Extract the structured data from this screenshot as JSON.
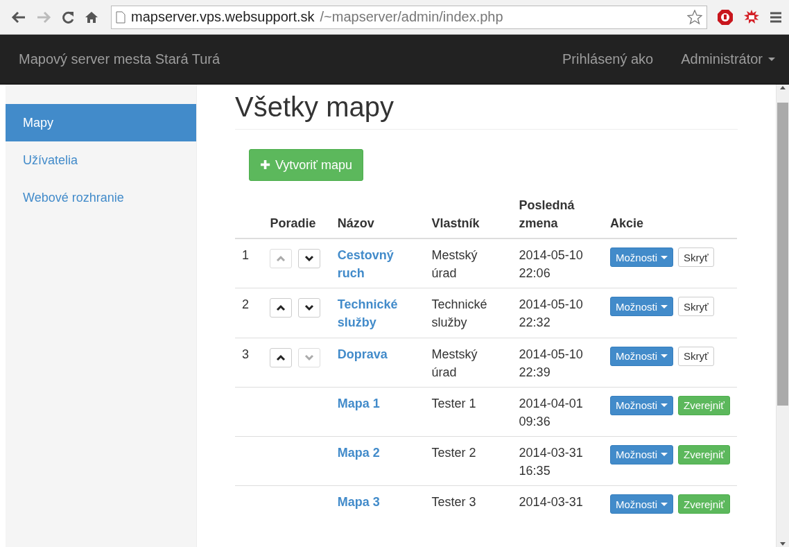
{
  "browser": {
    "url_host": "mapserver.vps.websupport.sk",
    "url_path": "/~mapserver/admin/index.php"
  },
  "navbar": {
    "brand": "Mapový server mesta Stará Turá",
    "logged_in_label": "Prihlásený ako",
    "user_menu": "Administrátor"
  },
  "sidebar": {
    "items": [
      {
        "label": "Mapy",
        "selected": true
      },
      {
        "label": "Užívatelia",
        "selected": false
      },
      {
        "label": "Webové rozhranie",
        "selected": false
      }
    ]
  },
  "page_title": "Všetky mapy",
  "create_button": {
    "icon": "✚",
    "label": "Vytvoriť mapu"
  },
  "table": {
    "columns": [
      "",
      "Poradie",
      "Názov",
      "Vlastník",
      "Posledná zmena",
      "Akcie"
    ],
    "rows": [
      {
        "order": "1",
        "up_disabled": true,
        "down_disabled": false,
        "name": "Cestovný ruch",
        "owner": "Mestský úrad",
        "changed": "2014-05-10 22:06",
        "options": "Možnosti",
        "visibility": {
          "kind": "hide",
          "label": "Skryť"
        }
      },
      {
        "order": "2",
        "up_disabled": false,
        "down_disabled": false,
        "name": "Technické služby",
        "owner": "Technické služby",
        "changed": "2014-05-10 22:32",
        "options": "Možnosti",
        "visibility": {
          "kind": "hide",
          "label": "Skryť"
        }
      },
      {
        "order": "3",
        "up_disabled": false,
        "down_disabled": true,
        "name": "Doprava",
        "owner": "Mestský úrad",
        "changed": "2014-05-10 22:39",
        "options": "Možnosti",
        "visibility": {
          "kind": "hide",
          "label": "Skryť"
        }
      },
      {
        "name": "Mapa 1",
        "owner": "Tester 1",
        "changed": "2014-04-01 09:36",
        "options": "Možnosti",
        "visibility": {
          "kind": "publish",
          "label": "Zverejniť"
        }
      },
      {
        "name": "Mapa 2",
        "owner": "Tester 2",
        "changed": "2014-03-31 16:35",
        "options": "Možnosti",
        "visibility": {
          "kind": "publish",
          "label": "Zverejniť"
        }
      },
      {
        "name": "Mapa 3",
        "owner": "Tester 3",
        "changed": "2014-03-31",
        "options": "Možnosti",
        "visibility": {
          "kind": "publish",
          "label": "Zverejniť"
        }
      }
    ]
  }
}
